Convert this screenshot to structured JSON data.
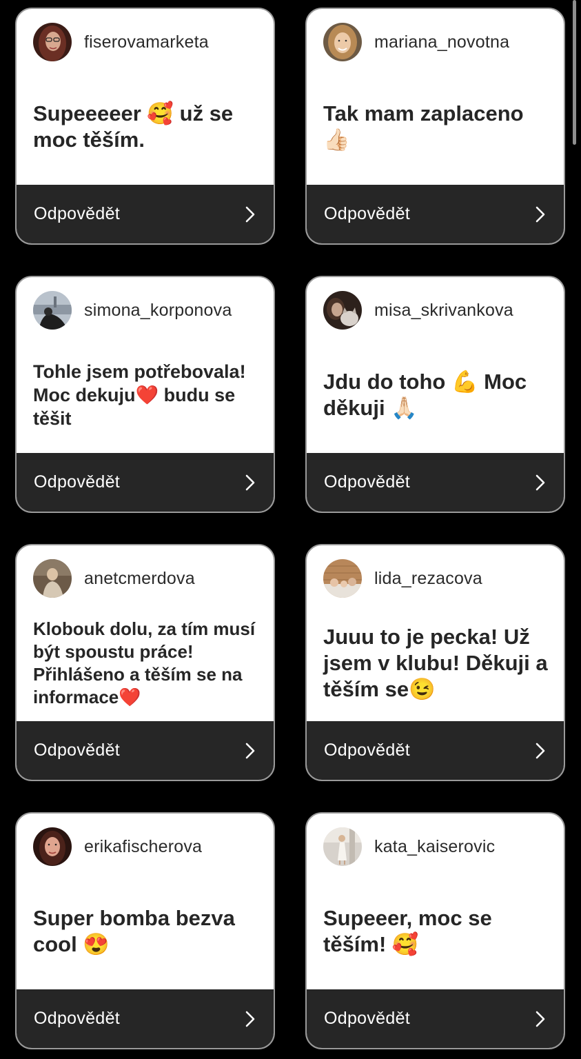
{
  "cards": [
    {
      "username": "fiserovamarketa",
      "message": "Supeeeeer 🥰 už se moc těším.",
      "reply_label": "Odpovědět",
      "avatar_icon": "avatar-woman-glasses",
      "avatar_colors": [
        "#5a2b22",
        "#c79a80"
      ]
    },
    {
      "username": "mariana_novotna",
      "message": "Tak mam zaplaceno 👍🏻",
      "reply_label": "Odpovědět",
      "avatar_icon": "avatar-woman-blonde",
      "avatar_colors": [
        "#8a6a3f",
        "#e8c7a4"
      ]
    },
    {
      "username": "simona_korponova",
      "message": "Tohle jsem potřebovala! Moc dekuju❤️ budu se těšit",
      "reply_label": "Odpovědět",
      "avatar_icon": "avatar-woman-city",
      "avatar_colors": [
        "#a8b4c2",
        "#222222"
      ]
    },
    {
      "username": "misa_skrivankova",
      "message": "Jdu do toho 💪 Moc děkuji 🙏🏻",
      "reply_label": "Odpovědět",
      "avatar_icon": "avatar-woman-cat",
      "avatar_colors": [
        "#3a2a24",
        "#c9b6a6"
      ]
    },
    {
      "username": "anetcmerdova",
      "message": "Klobouk dolu, za tím musí být spoustu práce! Přihlášeno a těším se na informace❤️",
      "reply_label": "Odpovědět",
      "avatar_icon": "avatar-woman-sitting",
      "avatar_colors": [
        "#5b4636",
        "#d8c6ae"
      ]
    },
    {
      "username": "lida_rezacova",
      "message": "Juuu to je pecka! Už jsem v klubu! Děkuji a těším se😉",
      "reply_label": "Odpovědět",
      "avatar_icon": "avatar-family",
      "avatar_colors": [
        "#b78a5c",
        "#e9dccd"
      ]
    },
    {
      "username": "erikafischerova",
      "message": "Super bomba bezva cool 😍",
      "reply_label": "Odpovědět",
      "avatar_icon": "avatar-woman-portrait",
      "avatar_colors": [
        "#3a1d16",
        "#d99a86"
      ]
    },
    {
      "username": "kata_kaiserovic",
      "message": "Supeeer, moc se těším! 🥰",
      "reply_label": "Odpovědět",
      "avatar_icon": "avatar-woman-street",
      "avatar_colors": [
        "#c9c3bb",
        "#f2efe9"
      ]
    }
  ]
}
